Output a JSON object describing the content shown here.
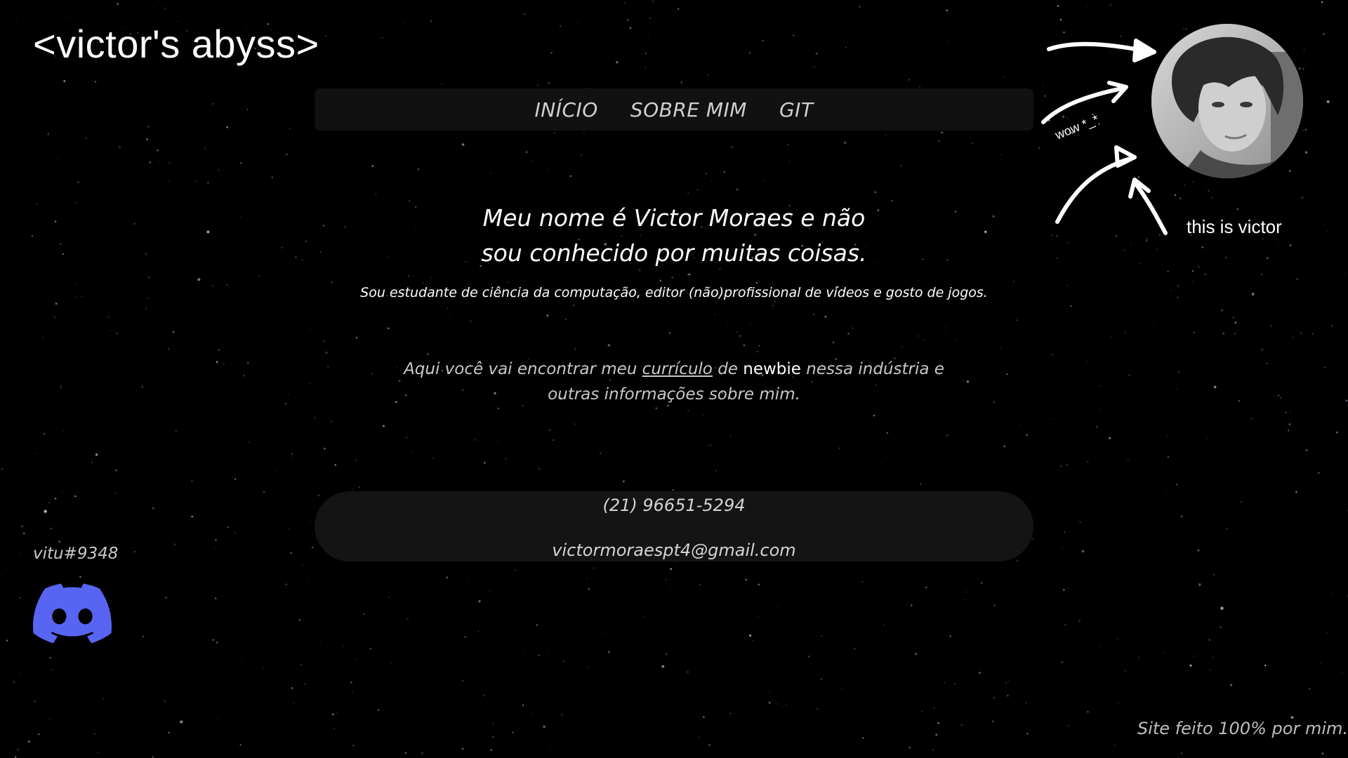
{
  "site": {
    "title": "<victor's abyss>"
  },
  "nav": {
    "items": [
      {
        "label": "INÍCIO"
      },
      {
        "label": "SOBRE MIM"
      },
      {
        "label": "GIT"
      }
    ]
  },
  "hero": {
    "title_line1": "Meu nome é Victor Moraes e não",
    "title_line2": "sou conhecido por muitas coisas.",
    "subtitle": "Sou estudante de ciência da computação, editor (não)profissional de vídeos e gosto de jogos."
  },
  "intro": {
    "part1": "Aqui você vai encontrar meu ",
    "link_text": "currículo",
    "part2": " de ",
    "highlight": "newbie",
    "part3": " nessa indústria e",
    "line2": "outras informações sobre mim."
  },
  "contact": {
    "phone": "(21) 96651-5294",
    "email": "victormoraespt4@gmail.com"
  },
  "discord": {
    "username": "vitu#9348",
    "icon": "discord-icon",
    "color": "#5865F2"
  },
  "profile": {
    "caption": "this is victor",
    "wow": "wow *_*"
  },
  "footer": {
    "note": "Site feito 100% por mim."
  },
  "colors": {
    "background": "#000000",
    "panel": "#141414",
    "discord": "#5865F2"
  }
}
